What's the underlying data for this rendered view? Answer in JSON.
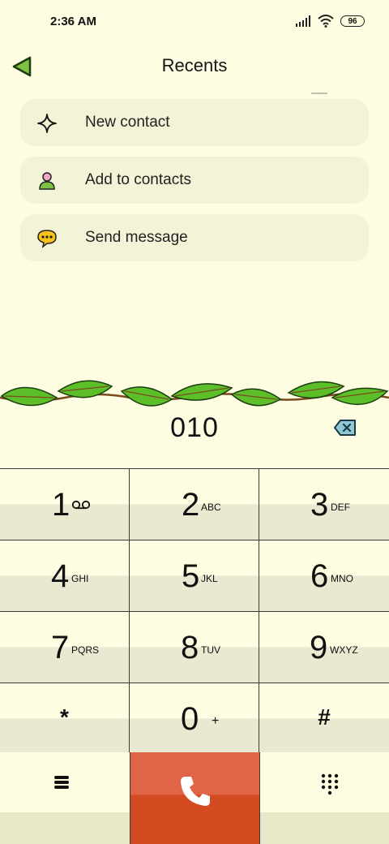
{
  "status_bar": {
    "time": "2:36 AM",
    "battery": "96"
  },
  "header": {
    "title": "Recents"
  },
  "actions": [
    {
      "label": "New contact",
      "icon": "plus-icon"
    },
    {
      "label": "Add to contacts",
      "icon": "person-icon"
    },
    {
      "label": "Send message",
      "icon": "chat-bubble-icon"
    }
  ],
  "dialer": {
    "number": "010",
    "keys": [
      {
        "digit": "1",
        "letters": ""
      },
      {
        "digit": "2",
        "letters": "ABC"
      },
      {
        "digit": "3",
        "letters": "DEF"
      },
      {
        "digit": "4",
        "letters": "GHI"
      },
      {
        "digit": "5",
        "letters": "JKL"
      },
      {
        "digit": "6",
        "letters": "MNO"
      },
      {
        "digit": "7",
        "letters": "PQRS"
      },
      {
        "digit": "8",
        "letters": "TUV"
      },
      {
        "digit": "9",
        "letters": "WXYZ"
      },
      {
        "digit": "*",
        "letters": ""
      },
      {
        "digit": "0",
        "letters": "+"
      },
      {
        "digit": "#",
        "letters": ""
      }
    ]
  },
  "colors": {
    "background": "#fefde2",
    "card": "#f3f3d8",
    "call_button": "#d44b22",
    "leaf": "#5cbf2a"
  }
}
